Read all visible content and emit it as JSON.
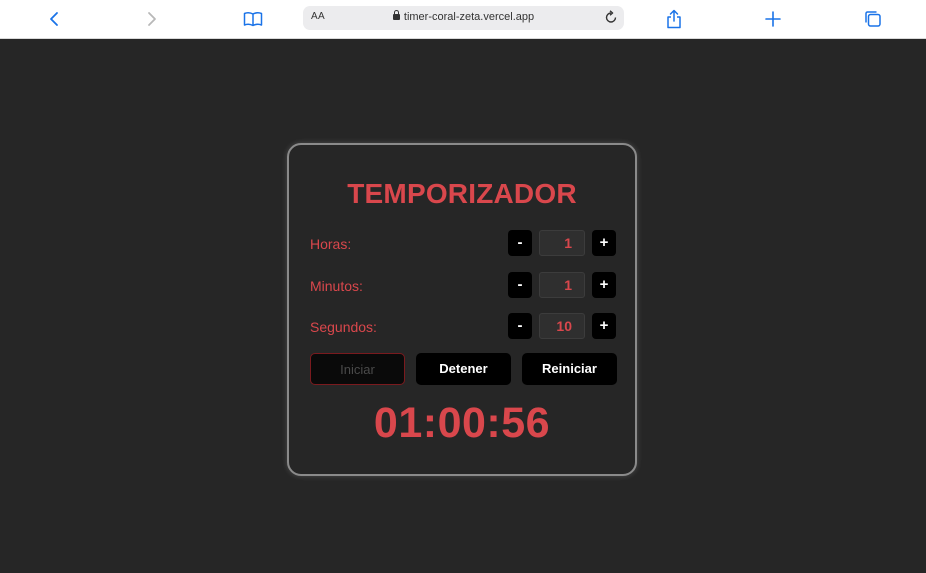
{
  "browser": {
    "aa_label": "AA",
    "url": "timer-coral-zeta.vercel.app",
    "accent_color": "#1a73e8"
  },
  "timer": {
    "title": "TEMPORIZADOR",
    "rows": [
      {
        "label": "Horas:",
        "value": "1",
        "minus": "-",
        "plus": "+"
      },
      {
        "label": "Minutos:",
        "value": "1",
        "minus": "-",
        "plus": "+"
      },
      {
        "label": "Segundos:",
        "value": "10",
        "minus": "-",
        "plus": "+"
      }
    ],
    "buttons": {
      "start": "Iniciar",
      "stop": "Detener",
      "reset": "Reiniciar"
    },
    "display": "01:00:56",
    "accent_color": "#d9474c"
  }
}
